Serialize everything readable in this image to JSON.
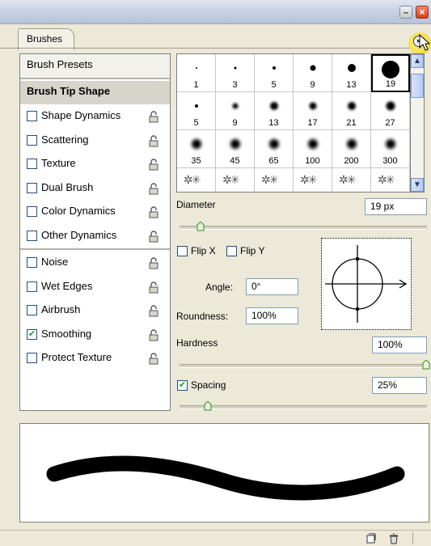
{
  "window": {
    "minimize_icon": "minimize-icon",
    "close_icon": "close-icon"
  },
  "tab": {
    "label": "Brushes"
  },
  "panel_menu_icon": "panel-menu-arrow-icon",
  "left_panel": {
    "presets_label": "Brush Presets",
    "tip_shape_label": "Brush Tip Shape",
    "options": [
      {
        "label": "Shape Dynamics",
        "checked": false
      },
      {
        "label": "Scattering",
        "checked": false
      },
      {
        "label": "Texture",
        "checked": false
      },
      {
        "label": "Dual Brush",
        "checked": false
      },
      {
        "label": "Color Dynamics",
        "checked": false
      },
      {
        "label": "Other Dynamics",
        "checked": false
      },
      {
        "label": "Noise",
        "checked": false
      },
      {
        "label": "Wet Edges",
        "checked": false
      },
      {
        "label": "Airbrush",
        "checked": false
      },
      {
        "label": "Smoothing",
        "checked": true
      },
      {
        "label": "Protect Texture",
        "checked": false
      }
    ],
    "lock_icon": "lock-icon"
  },
  "brush_grid": {
    "rows": [
      [
        "1",
        "3",
        "5",
        "9",
        "13",
        "19"
      ],
      [
        "5",
        "9",
        "13",
        "17",
        "21",
        "27"
      ],
      [
        "35",
        "45",
        "65",
        "100",
        "200",
        "300"
      ]
    ],
    "selected": "19"
  },
  "settings": {
    "diameter_label": "Diameter",
    "diameter_value": "19 px",
    "flip_x_label": "Flip X",
    "flip_y_label": "Flip Y",
    "angle_label": "Angle:",
    "angle_value": "0°",
    "roundness_label": "Roundness:",
    "roundness_value": "100%",
    "hardness_label": "Hardness",
    "hardness_value": "100%",
    "spacing_label": "Spacing",
    "spacing_checked": true,
    "spacing_value": "25%"
  },
  "statusbar": {
    "new_preset_icon": "new-preset-icon",
    "trash_icon": "trash-icon"
  }
}
